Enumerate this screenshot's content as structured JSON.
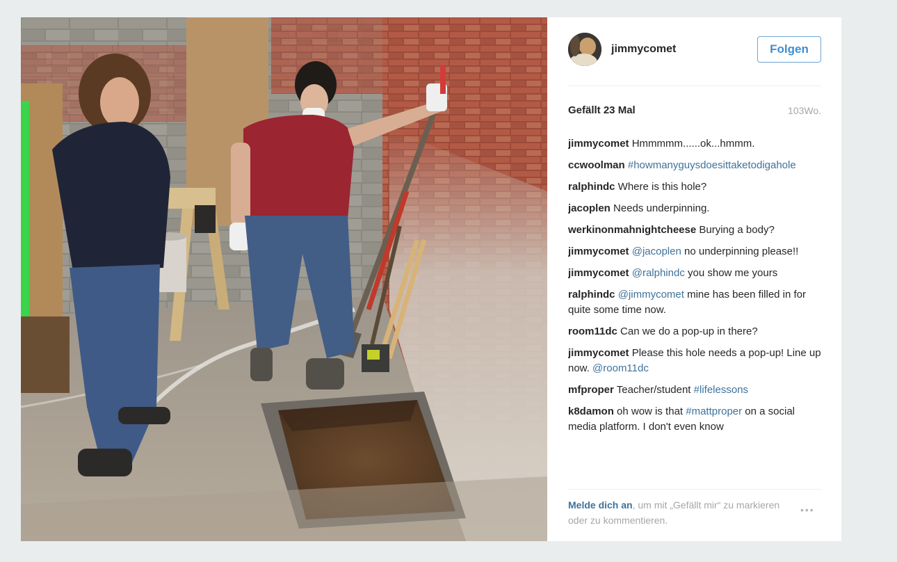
{
  "post": {
    "username": "jimmycomet",
    "follow_label": "Folgen",
    "likes": "Gefällt 23 Mal",
    "age": "103Wo.",
    "more_label": "•••"
  },
  "comments": [
    {
      "author": "jimmycomet",
      "parts": [
        {
          "text": " Hmmmmm......ok...hmmm."
        }
      ]
    },
    {
      "author": "ccwoolman",
      "parts": [
        {
          "text": " "
        },
        {
          "text": "#howmanyguysdoesittaketodigahole",
          "tag": true
        }
      ]
    },
    {
      "author": "ralphindc",
      "parts": [
        {
          "text": " Where is this hole?"
        }
      ]
    },
    {
      "author": "jacoplen",
      "parts": [
        {
          "text": " Needs underpinning."
        }
      ]
    },
    {
      "author": "werkinonmahnightcheese",
      "parts": [
        {
          "text": " Burying a body?"
        }
      ]
    },
    {
      "author": "jimmycomet",
      "parts": [
        {
          "text": " "
        },
        {
          "text": "@jacoplen",
          "tag": true
        },
        {
          "text": " no underpinning please!!"
        }
      ]
    },
    {
      "author": "jimmycomet",
      "parts": [
        {
          "text": " "
        },
        {
          "text": "@ralphindc",
          "tag": true
        },
        {
          "text": " you show me yours"
        }
      ]
    },
    {
      "author": "ralphindc",
      "parts": [
        {
          "text": " "
        },
        {
          "text": "@jimmycomet",
          "tag": true
        },
        {
          "text": " mine has been filled in for quite some time now."
        }
      ]
    },
    {
      "author": "room11dc",
      "parts": [
        {
          "text": " Can we do a pop-up in there?"
        }
      ]
    },
    {
      "author": "jimmycomet",
      "parts": [
        {
          "text": " Please this hole needs a pop-up! Line up now. "
        },
        {
          "text": "@room11dc",
          "tag": true
        }
      ]
    },
    {
      "author": "mfproper",
      "parts": [
        {
          "text": " Teacher/student "
        },
        {
          "text": "#lifelessons",
          "tag": true
        }
      ]
    },
    {
      "author": "k8damon",
      "parts": [
        {
          "text": " oh wow is that "
        },
        {
          "text": "#mattproper",
          "tag": true
        },
        {
          "text": " on a social media platform. I don't even know"
        }
      ]
    }
  ],
  "login": {
    "link": "Melde dich an",
    "text": ", um mit „Gefällt mir“ zu markieren oder zu kommentieren."
  },
  "colors": {
    "background": "#e9edee",
    "link": "#3f729b",
    "follow": "#3f8dd1"
  }
}
